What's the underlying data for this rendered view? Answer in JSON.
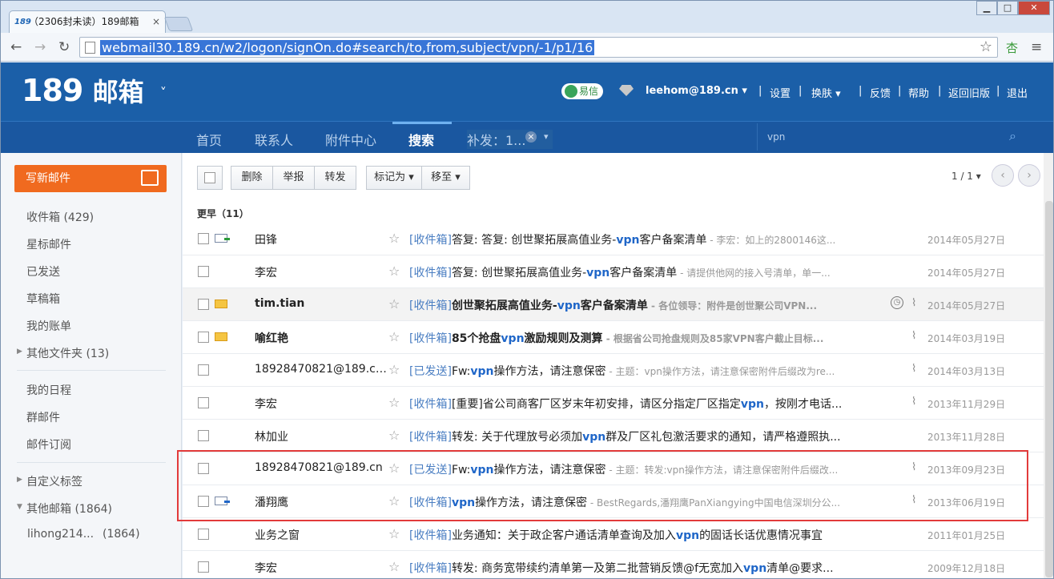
{
  "browser": {
    "tab_title": "（2306封未读）189邮箱",
    "tab_icon": "189",
    "tab_close": "×",
    "url": "webmail30.189.cn/w2/logon/signOn.do#search/to,from,subject/vpn/-1/p1/16",
    "window_buttons": [
      "▁",
      "□",
      "✕"
    ]
  },
  "header": {
    "logo_num": "189",
    "logo_cn": "邮箱",
    "logo_dd": "˅",
    "yixin": "易信",
    "user": "leehom@189.cn ▾",
    "links": [
      "|",
      "设置",
      "|",
      "换肤 ▾",
      "|",
      "反馈",
      "|",
      "帮助",
      "|",
      "返回旧版",
      "|",
      "退出"
    ]
  },
  "nav": {
    "tabs": [
      "首页",
      "联系人",
      "附件中心",
      "搜索",
      "补发：1..."
    ],
    "close": "×",
    "more": "▾",
    "search_query": "vpn"
  },
  "sidebar": {
    "compose": "写新邮件",
    "folders": [
      "收件箱 (429)",
      "星标邮件",
      "已发送",
      "草稿箱",
      "我的账单",
      "其他文件夹 (13)"
    ],
    "apps": [
      "我的日程",
      "群邮件",
      "邮件订阅"
    ],
    "labels": [
      "自定义标签",
      "其他邮箱 (1864)"
    ],
    "account": "lihong214...",
    "account_count": "(1864)"
  },
  "toolbar": {
    "delete": "删除",
    "report": "举报",
    "forward": "转发",
    "mark_as": "标记为 ▾",
    "move_to": "移至 ▾",
    "page": "1 / 1 ▾",
    "prev": "‹",
    "next": "›"
  },
  "group_label": "更早（11）",
  "emails": [
    {
      "sender": "田锋",
      "folder": "[收件箱]",
      "subject": "答复: 答复: 创世聚拓展高值业务-vpn客户备案清单",
      "preview": "李宏：如上的2800146这...",
      "date": "2014年05月27日"
    },
    {
      "sender": "李宏",
      "folder": "[收件箱]",
      "subject": "答复: 创世聚拓展高值业务-vpn客户备案清单",
      "preview": "请提供他网的接入号清单，单一...",
      "date": "2014年05月27日"
    },
    {
      "sender": "tim.tian",
      "folder": "[收件箱]",
      "subject": "创世聚拓展高值业务-vpn客户备案清单",
      "preview": "各位领导：附件是创世聚公司VPN...",
      "date": "2014年05月27日",
      "clock": "◷"
    },
    {
      "sender": "喻红艳",
      "folder": "[收件箱]",
      "subject": "85个抢盘vpn激励规则及测算",
      "preview": "根据省公司抢盘规则及85家VPN客户截止目标...",
      "date": "2014年03月19日"
    },
    {
      "sender": "18928470821@189.cn,1...",
      "folder": "[已发送]",
      "subject": "Fw:vpn操作方法，请注意保密",
      "preview": "主题：vpn操作方法，请注意保密附件后缀改为re...",
      "date": "2014年03月13日"
    },
    {
      "sender": "李宏",
      "folder": "[收件箱]",
      "subject": "[重要]省公司商客厂区岁末年初安排，请区分指定厂区指定vpn，按刚才电话...",
      "preview": "",
      "date": "2013年11月29日"
    },
    {
      "sender": "林加业",
      "folder": "[收件箱]",
      "subject": "转发: 关于代理放号必须加vpn群及厂区礼包激活要求的通知，请严格遵照执...",
      "preview": "",
      "date": "2013年11月28日"
    },
    {
      "sender": "18928470821@189.cn",
      "folder": "[已发送]",
      "subject": "Fw:vpn操作方法，请注意保密",
      "preview": "主题：转发:vpn操作方法，请注意保密附件后缀改...",
      "date": "2013年09月23日"
    },
    {
      "sender": "潘翔鹰",
      "folder": "[收件箱]",
      "subject": "vpn操作方法，请注意保密",
      "preview": "BestRegards,潘翔鹰PanXiangying中国电信深圳分公...",
      "date": "2013年06月19日"
    },
    {
      "sender": "业务之窗",
      "folder": "[收件箱]",
      "subject": "业务通知：关于政企客户通话清单查询及加入vpn的固话长话优惠情况事宜",
      "preview": "",
      "date": "2011年01月25日"
    },
    {
      "sender": "李宏",
      "folder": "[收件箱]",
      "subject": "转发: 商务宽带续约清单第一及第二批营销反馈@f无宽加入vpn清单@要求...",
      "preview": "",
      "date": "2009年12月18日"
    }
  ],
  "glyphs": {
    "star": "☆",
    "clip": "⌕",
    "back": "←",
    "forward": "→",
    "reload": "↻",
    "bookmark": "☆",
    "ext": "杏",
    "menu": "≡",
    "search": "⌕"
  }
}
